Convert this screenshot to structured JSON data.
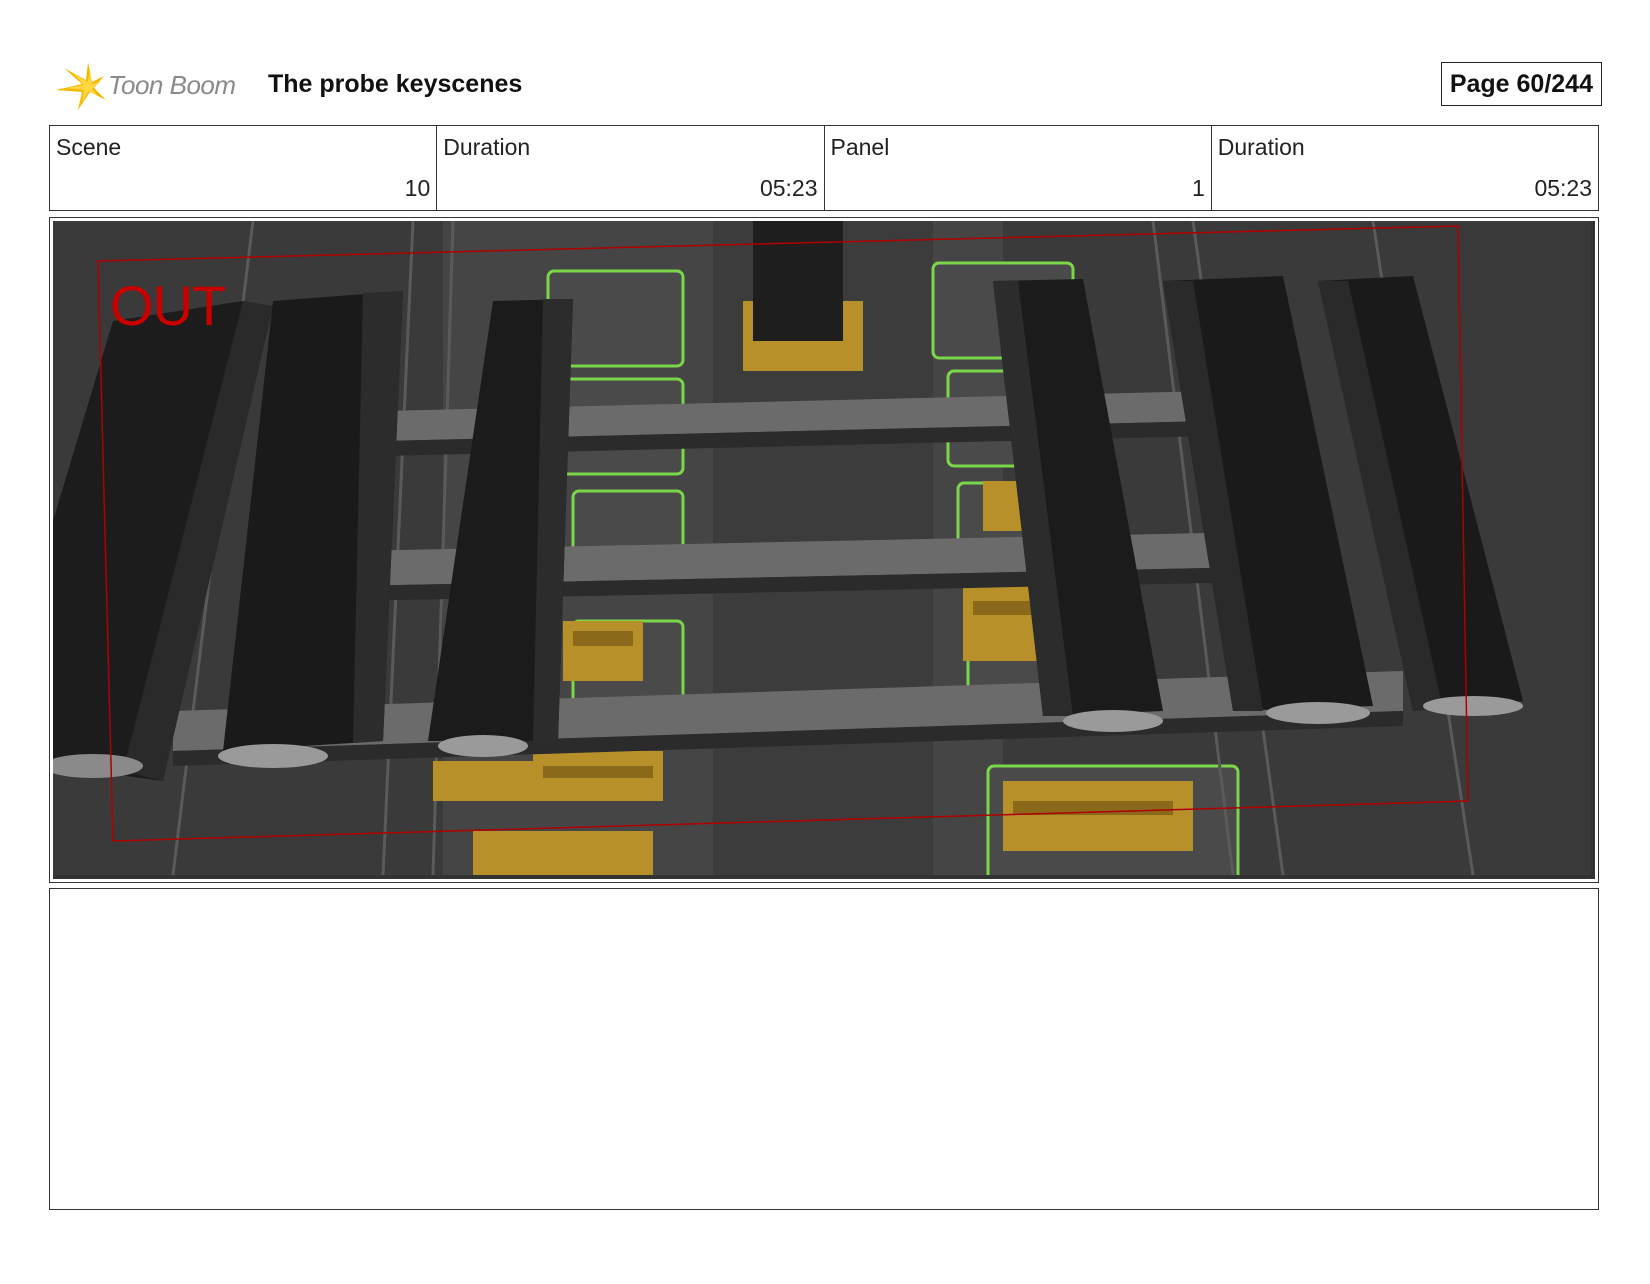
{
  "header": {
    "logo_text": "Toon Boom",
    "title": "The probe keyscenes",
    "page_label": "Page  60/244"
  },
  "info": {
    "scene_label": "Scene",
    "scene_value": "10",
    "scene_duration_label": "Duration",
    "scene_duration_value": "05:23",
    "panel_label": "Panel",
    "panel_value": "1",
    "panel_duration_label": "Duration",
    "panel_duration_value": "05:23"
  },
  "frame": {
    "overlay_text": "OUT",
    "overlay_color": "#c80000",
    "accent_green": "#7bd64a",
    "accent_gold": "#b8902a"
  },
  "notes": {
    "text": ""
  }
}
